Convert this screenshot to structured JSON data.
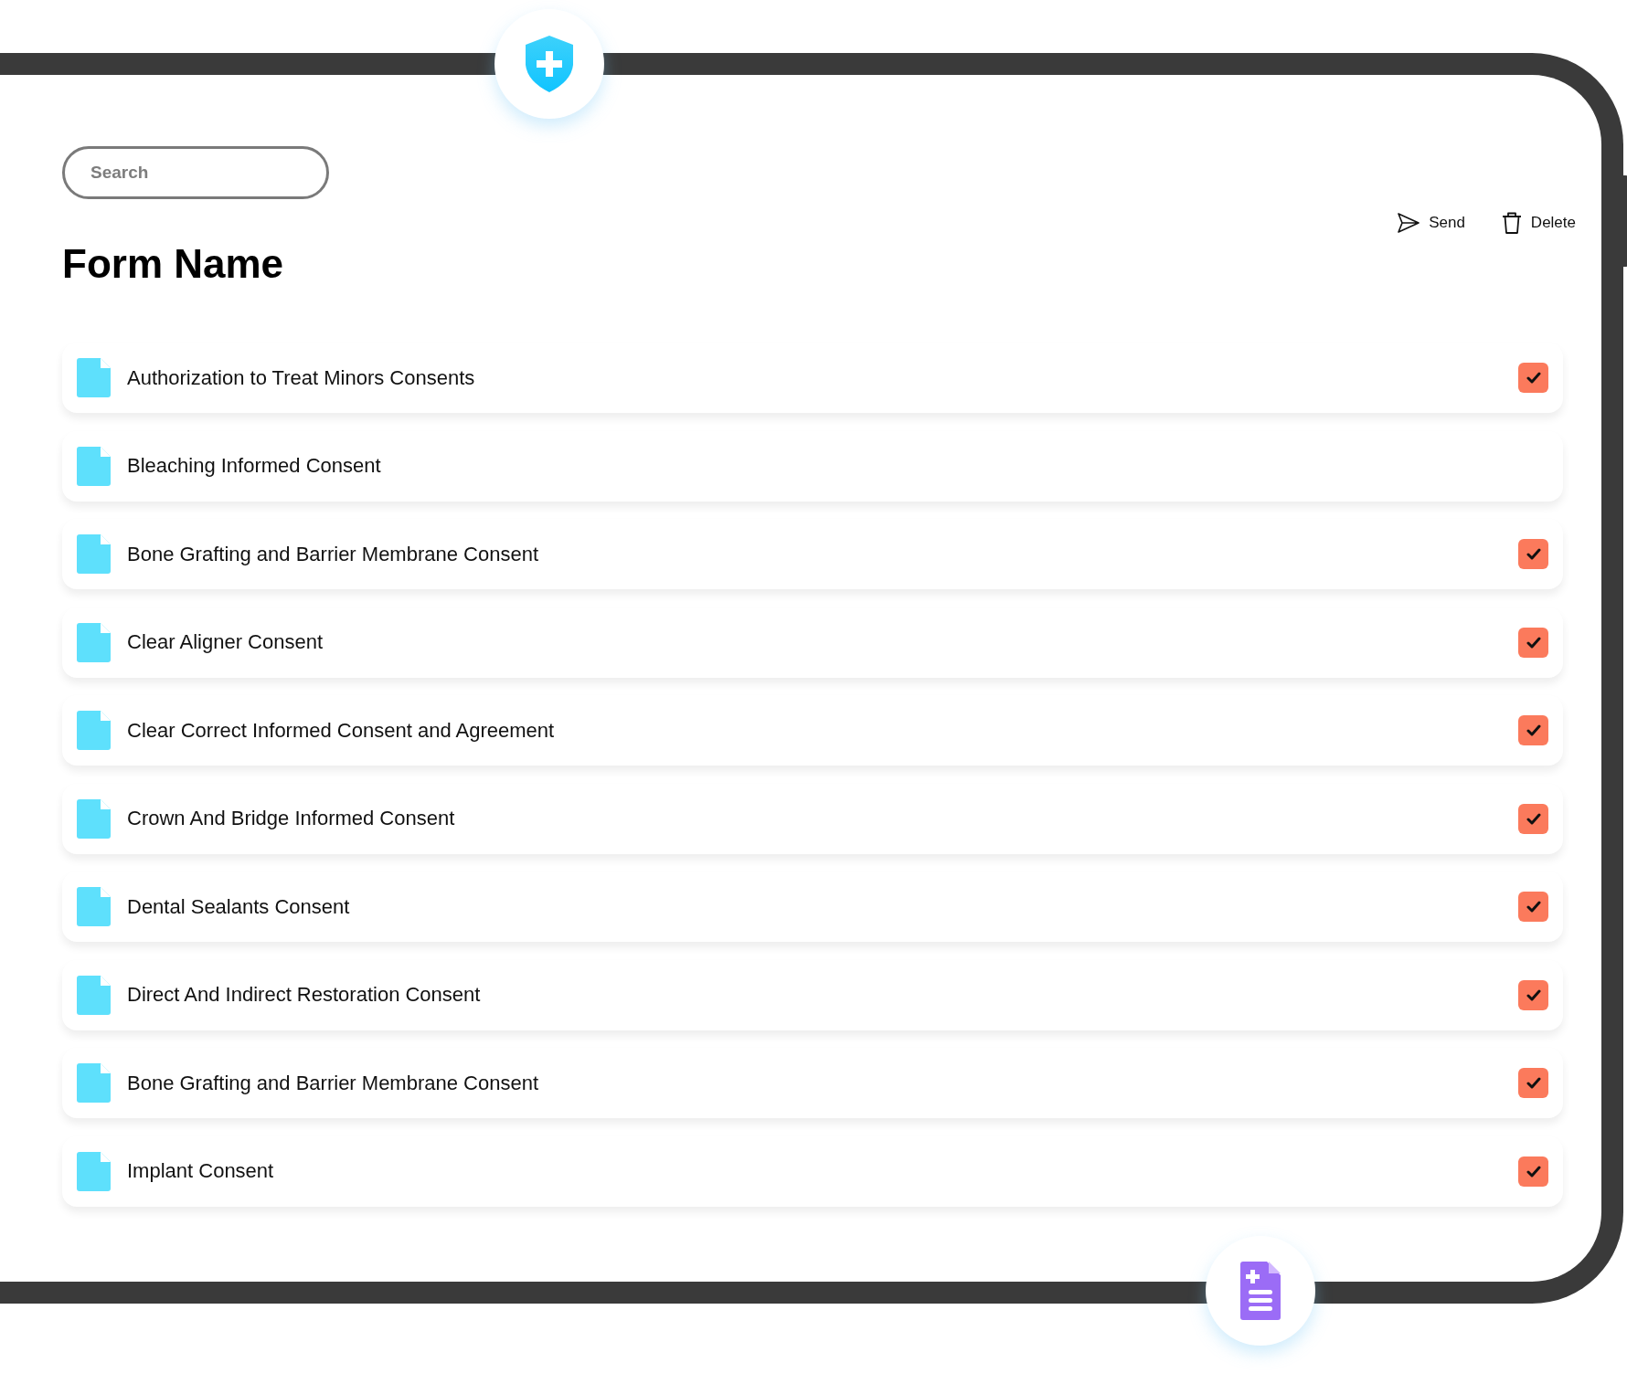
{
  "search": {
    "placeholder": "Search"
  },
  "title": "Form Name",
  "actions": [
    {
      "kind": "send",
      "label": "Send"
    },
    {
      "kind": "delete",
      "label": "Delete"
    }
  ],
  "forms": [
    {
      "name": "Authorization to Treat Minors Consents",
      "checked": true
    },
    {
      "name": "Bleaching Informed Consent",
      "checked": false
    },
    {
      "name": "Bone Grafting and Barrier Membrane Consent",
      "checked": true
    },
    {
      "name": "Clear Aligner Consent",
      "checked": true
    },
    {
      "name": "Clear Correct Informed Consent and Agreement",
      "checked": true
    },
    {
      "name": "Crown And Bridge Informed Consent",
      "checked": true
    },
    {
      "name": "Dental Sealants Consent",
      "checked": true
    },
    {
      "name": "Direct And Indirect Restoration Consent",
      "checked": true
    },
    {
      "name": "Bone Grafting and Barrier Membrane Consent",
      "checked": true
    },
    {
      "name": "Implant Consent",
      "checked": true
    }
  ]
}
